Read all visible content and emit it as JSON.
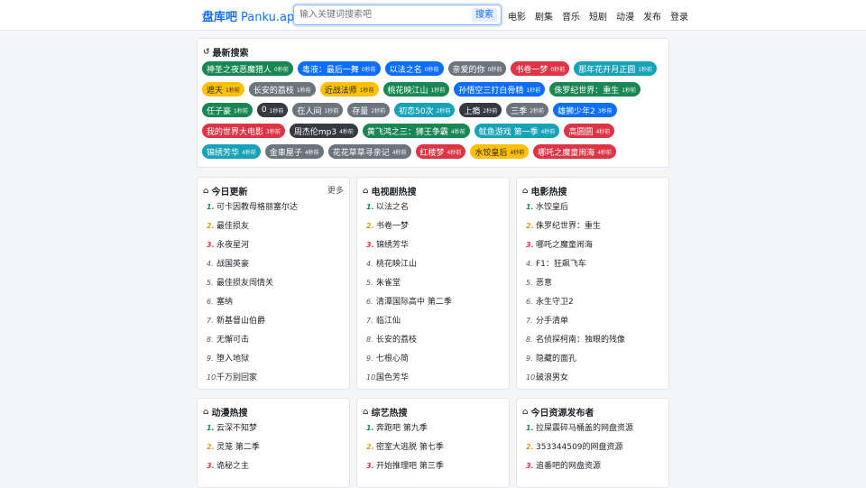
{
  "brand": {
    "name": "盘库吧",
    "app": "Panku.app"
  },
  "search": {
    "placeholder": "输入关键词搜索吧",
    "button": "搜索"
  },
  "nav": [
    "电影",
    "剧集",
    "音乐",
    "短剧",
    "动漫",
    "发布",
    "登录"
  ],
  "recent": {
    "title": "最新搜索",
    "tags": [
      {
        "text": "神圣之夜恶魔猎人",
        "time": "0秒前",
        "color": "#198754"
      },
      {
        "text": "毒液：最后一舞",
        "time": "0秒前",
        "color": "#0d6efd"
      },
      {
        "text": "以法之名",
        "time": "0秒前",
        "color": "#0d6efd"
      },
      {
        "text": "亲爱的你",
        "time": "0秒前",
        "color": "#6c757d"
      },
      {
        "text": "书卷一梦",
        "time": "0秒前",
        "color": "#dc3545"
      },
      {
        "text": "那年花开月正圆",
        "time": "1秒前",
        "color": "#17a2b8"
      },
      {
        "text": "遮天",
        "time": "1秒前",
        "color": "#ffc107",
        "dark": true
      },
      {
        "text": "长安的荔枝",
        "time": "1秒前",
        "color": "#6c757d"
      },
      {
        "text": "近战法师",
        "time": "1秒前",
        "color": "#ffc107",
        "dark": true
      },
      {
        "text": "桃花映江山",
        "time": "1秒前",
        "color": "#198754"
      },
      {
        "text": "孙悟空三打白骨精",
        "time": "1秒前",
        "color": "#0d6efd"
      },
      {
        "text": "侏罗纪世界：重生",
        "time": "1秒前",
        "color": "#198754"
      },
      {
        "text": "任子豪",
        "time": "1秒前",
        "color": "#198754"
      },
      {
        "text": "0",
        "time": "1秒前",
        "color": "#343a40"
      },
      {
        "text": "在人间",
        "time": "1秒前",
        "color": "#6c757d"
      },
      {
        "text": "存量",
        "time": "2秒前",
        "color": "#6c757d"
      },
      {
        "text": "初恋50次",
        "time": "2秒前",
        "color": "#17a2b8"
      },
      {
        "text": "上瘾",
        "time": "2秒前",
        "color": "#343a40"
      },
      {
        "text": "三季",
        "time": "2秒前",
        "color": "#6c757d"
      },
      {
        "text": "雄狮少年2",
        "time": "3秒前",
        "color": "#0d6efd"
      },
      {
        "text": "我的世界大电影",
        "time": "3秒前",
        "color": "#dc3545"
      },
      {
        "text": "周杰伦mp3",
        "time": "4秒前",
        "color": "#343a40"
      },
      {
        "text": "黄飞鸿之三：狮王争霸",
        "time": "4秒前",
        "color": "#198754"
      },
      {
        "text": "鱿鱼游戏 第一季",
        "time": "4秒前",
        "color": "#17a2b8"
      },
      {
        "text": "高圆圆",
        "time": "4秒前",
        "color": "#dc3545"
      },
      {
        "text": "锦绣芳华",
        "time": "4秒前",
        "color": "#17a2b8"
      },
      {
        "text": "金車屋子",
        "time": "4秒前",
        "color": "#6c757d"
      },
      {
        "text": "花花草草寻亲记",
        "time": "4秒前",
        "color": "#6c757d"
      },
      {
        "text": "红楼梦",
        "time": "4秒前",
        "color": "#dc3545"
      },
      {
        "text": "水饺皇后",
        "time": "4秒前",
        "color": "#ffc107",
        "dark": true
      },
      {
        "text": "哪吒之魔童闹海",
        "time": "4秒前",
        "color": "#dc3545"
      }
    ]
  },
  "panels": [
    {
      "title": "今日更新",
      "more": "更多",
      "items": [
        "可卡因教母格丽塞尔达",
        "最佳损友",
        "永夜星河",
        "战国英豪",
        "最佳损友闯情关",
        "塞纳",
        "新基督山伯爵",
        "无懈可击",
        "堕入地狱",
        "千万别回家"
      ]
    },
    {
      "title": "电视剧热搜",
      "items": [
        "以法之名",
        "书卷一梦",
        "锦绣芳华",
        "桃花映江山",
        "朱雀堂",
        "清潭国际高中 第二季",
        "临江仙",
        "长安的荔枝",
        "七根心简",
        "国色芳华"
      ]
    },
    {
      "title": "电影热搜",
      "items": [
        "水饺皇后",
        "侏罗纪世界：重生",
        "哪吒之魔童闹海",
        "F1：狂飙飞车",
        "恶意",
        "永生守卫2",
        "分手清单",
        "名侦探柯南：独眼的残像",
        "隐藏的面孔",
        "破浪男女"
      ]
    },
    {
      "title": "动漫热搜",
      "items": [
        "云深不知梦",
        "灵笼 第二季",
        "诡秘之主"
      ]
    },
    {
      "title": "综艺热搜",
      "items": [
        "奔跑吧 第九季",
        "密室大逃脱 第七季",
        "开始推理吧 第三季"
      ]
    },
    {
      "title": "今日资源发布者",
      "items": [
        "拉屎震碎马桶盖的网盘资源",
        "353344509的网盘资源",
        "追番吧的网盘资源"
      ]
    }
  ]
}
